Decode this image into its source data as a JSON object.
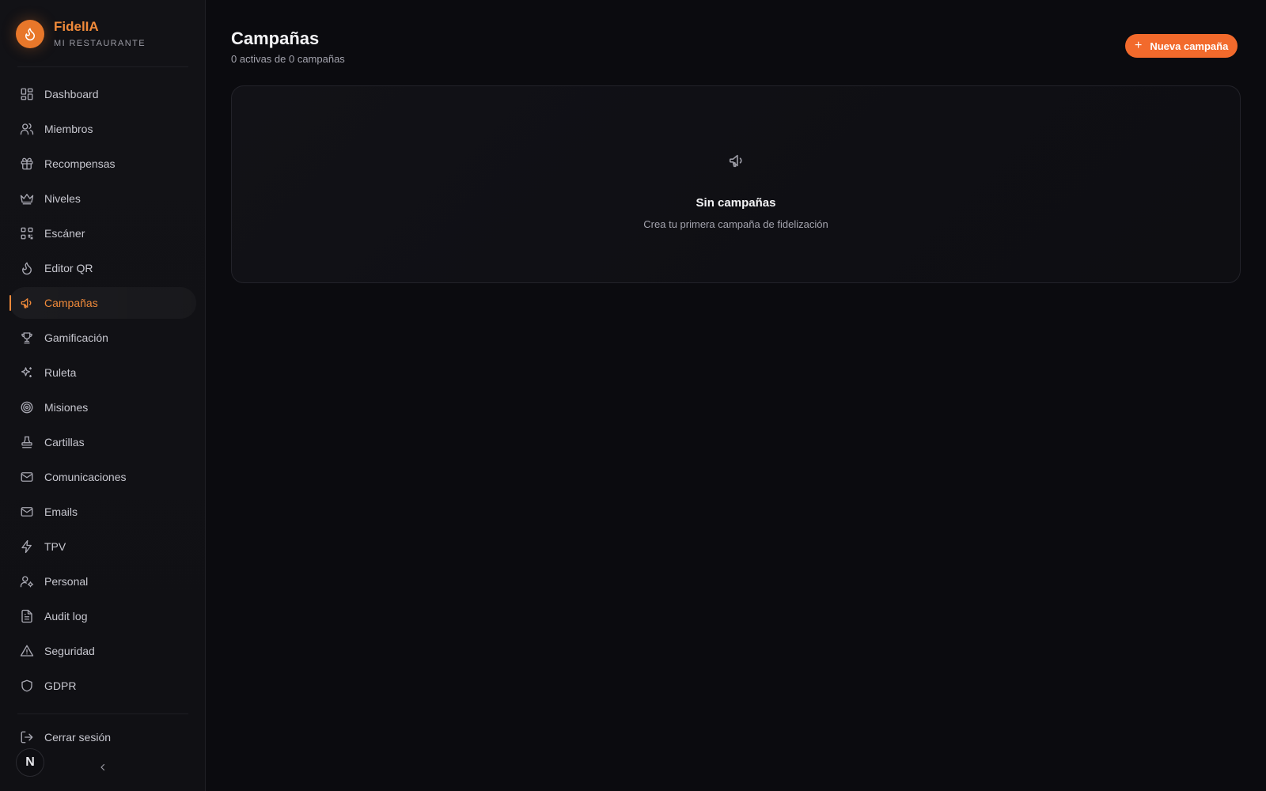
{
  "brand": {
    "name": "FidelIA",
    "subtitle": "MI RESTAURANTE"
  },
  "sidebar": {
    "items": [
      {
        "label": "Dashboard",
        "icon": "dashboard-icon"
      },
      {
        "label": "Miembros",
        "icon": "users-icon"
      },
      {
        "label": "Recompensas",
        "icon": "gift-icon"
      },
      {
        "label": "Niveles",
        "icon": "crown-icon"
      },
      {
        "label": "Escáner",
        "icon": "qr-scan-icon"
      },
      {
        "label": "Editor QR",
        "icon": "flame-icon"
      },
      {
        "label": "Campañas",
        "icon": "megaphone-icon",
        "active": true
      },
      {
        "label": "Gamificación",
        "icon": "trophy-icon"
      },
      {
        "label": "Ruleta",
        "icon": "sparkles-icon"
      },
      {
        "label": "Misiones",
        "icon": "target-icon"
      },
      {
        "label": "Cartillas",
        "icon": "stamp-icon"
      },
      {
        "label": "Comunicaciones",
        "icon": "mail-icon"
      },
      {
        "label": "Emails",
        "icon": "mail-icon"
      },
      {
        "label": "TPV",
        "icon": "bolt-icon"
      },
      {
        "label": "Personal",
        "icon": "user-gear-icon"
      },
      {
        "label": "Audit log",
        "icon": "file-text-icon"
      },
      {
        "label": "Seguridad",
        "icon": "warning-icon"
      },
      {
        "label": "GDPR",
        "icon": "shield-icon"
      }
    ],
    "logout_label": "Cerrar sesión",
    "avatar_letter": "N"
  },
  "main": {
    "title": "Campañas",
    "subtitle": "0 activas de 0 campañas",
    "new_button_label": "Nueva campaña",
    "empty_title": "Sin campañas",
    "empty_description": "Crea tu primera campaña de fidelización"
  },
  "colors": {
    "accent": "#f26a2c",
    "brand": "#f08a3a",
    "background": "#0b0b0f"
  }
}
